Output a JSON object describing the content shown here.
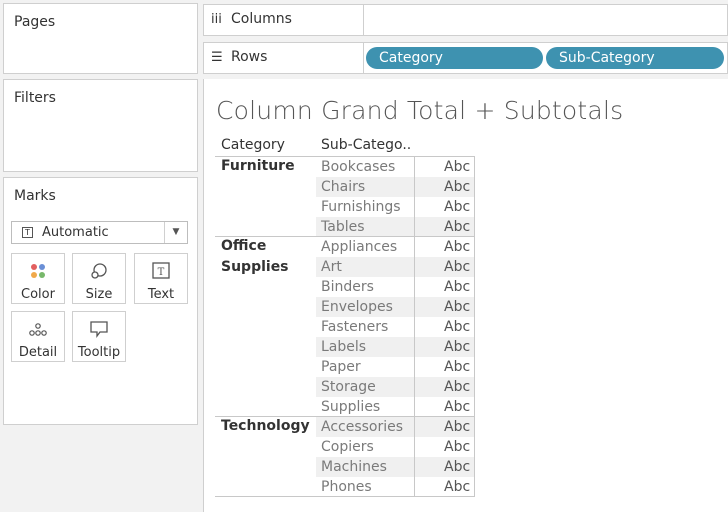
{
  "panels": {
    "pages": "Pages",
    "filters": "Filters",
    "marks": "Marks"
  },
  "shelves": {
    "columns": "Columns",
    "rows": "Rows",
    "row_pills": [
      "Category",
      "Sub-Category"
    ]
  },
  "marks_card": {
    "mark_type": "Automatic",
    "buttons": [
      "Color",
      "Size",
      "Text",
      "Detail",
      "Tooltip"
    ]
  },
  "view": {
    "title": "Column Grand Total + Subtotals",
    "headers": [
      "Category",
      "Sub-Catego.."
    ],
    "categories": [
      {
        "line1": "Furniture",
        "line2": ""
      },
      {
        "line1": "Office",
        "line2": "Supplies"
      },
      {
        "line1": "Technology",
        "line2": ""
      }
    ],
    "rows": [
      {
        "sub": "Bookcases",
        "val": "Abc"
      },
      {
        "sub": "Chairs",
        "val": "Abc"
      },
      {
        "sub": "Furnishings",
        "val": "Abc"
      },
      {
        "sub": "Tables",
        "val": "Abc"
      },
      {
        "sub": "Appliances",
        "val": "Abc"
      },
      {
        "sub": "Art",
        "val": "Abc"
      },
      {
        "sub": "Binders",
        "val": "Abc"
      },
      {
        "sub": "Envelopes",
        "val": "Abc"
      },
      {
        "sub": "Fasteners",
        "val": "Abc"
      },
      {
        "sub": "Labels",
        "val": "Abc"
      },
      {
        "sub": "Paper",
        "val": "Abc"
      },
      {
        "sub": "Storage",
        "val": "Abc"
      },
      {
        "sub": "Supplies",
        "val": "Abc"
      },
      {
        "sub": "Accessories",
        "val": "Abc"
      },
      {
        "sub": "Copiers",
        "val": "Abc"
      },
      {
        "sub": "Machines",
        "val": "Abc"
      },
      {
        "sub": "Phones",
        "val": "Abc"
      }
    ]
  },
  "colors": {
    "pill": "#3e92b0"
  }
}
